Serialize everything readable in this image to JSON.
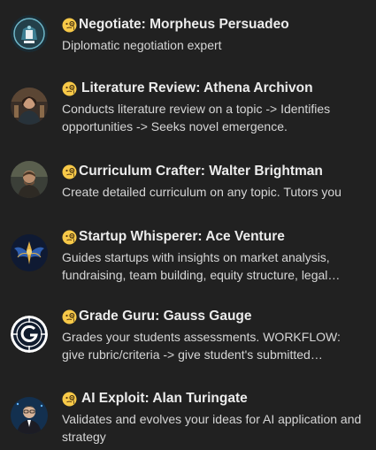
{
  "gpts": [
    {
      "name": "Negotiate: Morpheus Persuadeo",
      "description": "Diplomatic negotiation expert",
      "emoji": "face-with-monocle"
    },
    {
      "name": "Literature Review: Athena Archivon",
      "description": "Conducts literature review on a topic -> Identifies opportunities -> Seeks novel emergence.",
      "emoji": "face-with-monocle"
    },
    {
      "name": "Curriculum Crafter: Walter Brightman",
      "description": "Create detailed curriculum on any topic. Tutors you",
      "emoji": "face-with-monocle"
    },
    {
      "name": "Startup Whisperer: Ace Venture",
      "description": "Guides startups with insights on market analysis, fundraising, team building, equity structure, legal considerations, and more.",
      "emoji": "face-with-monocle"
    },
    {
      "name": "Grade Guru: Gauss Gauge",
      "description": "Grades your students assessments. WORKFLOW: give rubric/criteria -> give student's submitted assessment.",
      "emoji": "face-with-monocle"
    },
    {
      "name": "AI Exploit: Alan Turingate",
      "description": "Validates and evolves your ideas for AI application and strategy",
      "emoji": "face-with-monocle"
    }
  ]
}
